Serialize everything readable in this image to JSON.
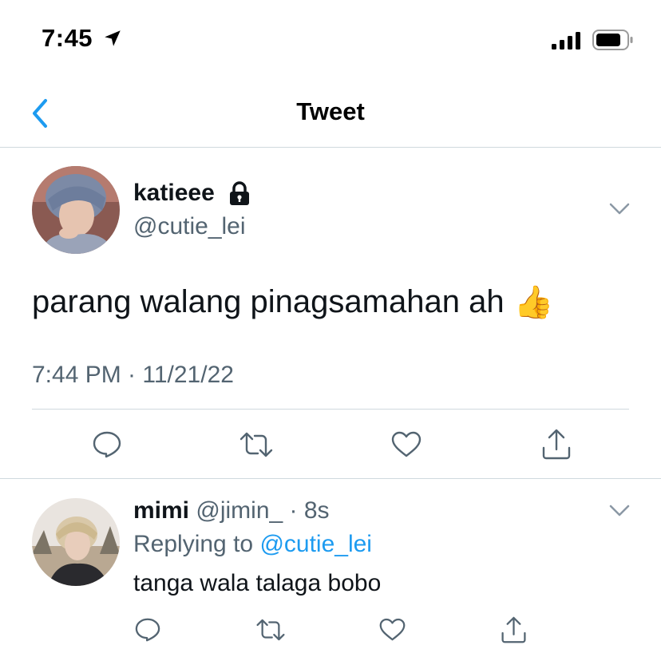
{
  "status_bar": {
    "time": "7:45",
    "icons": [
      "location-arrow-icon",
      "signal-icon",
      "battery-icon"
    ]
  },
  "nav": {
    "title": "Tweet",
    "back_icon": "chevron-left-icon",
    "accent_color": "#1d9bf0"
  },
  "tweet": {
    "author_name": "katieee",
    "author_handle": "@cutie_lei",
    "protected_icon": "lock-icon",
    "text": "parang walang pinagsamahan ah",
    "emoji": "👍",
    "timestamp": "7:44 PM · 11/21/22",
    "actions": [
      "reply-icon",
      "retweet-icon",
      "like-icon",
      "share-icon"
    ]
  },
  "reply": {
    "author_name": "mimi",
    "author_handle": "@jimin_",
    "separator": "·",
    "time": "8s",
    "replying_label": "Replying to",
    "replying_mention": "@cutie_lei",
    "text": "tanga wala talaga bobo",
    "actions": [
      "reply-icon",
      "retweet-icon",
      "like-icon",
      "share-icon"
    ]
  },
  "colors": {
    "text_primary": "#0f1419",
    "text_secondary": "#536471",
    "divider": "#cfd9de",
    "link": "#1d9bf0"
  }
}
